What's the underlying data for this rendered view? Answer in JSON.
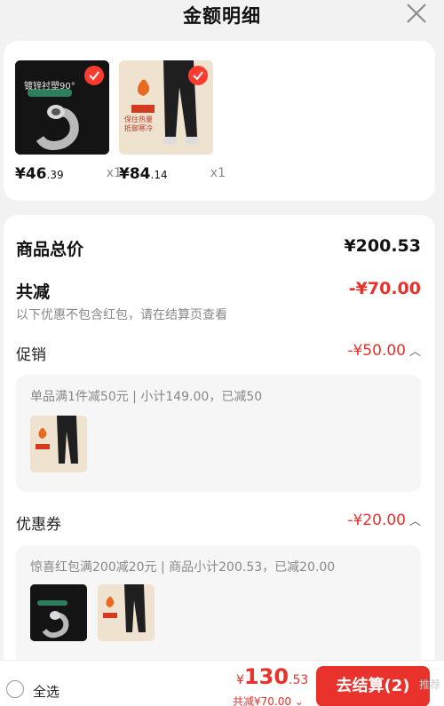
{
  "header": {
    "title": "金额明细"
  },
  "products": [
    {
      "thumb_text": "镀锌衬塑90°",
      "price_int": "¥46",
      "price_dec": ".39",
      "qty": "x1"
    },
    {
      "thumb_text": "保住热量 抵御寒冷",
      "price_int": "¥84",
      "price_dec": ".14",
      "qty": "x1"
    }
  ],
  "summary": {
    "goods_total_label": "商品总价",
    "goods_total_value": "¥200.53",
    "discount_label": "共减",
    "discount_value": "-¥70.00",
    "discount_hint": "以下优惠不包含红包，请在结算页查看"
  },
  "promotion": {
    "label": "促销",
    "value": "-¥50.00",
    "desc": "单品满1件减50元 | 小计149.00，已减50"
  },
  "coupon": {
    "label": "优惠券",
    "value": "-¥20.00",
    "desc": "惊喜红包满200减20元 | 商品小计200.53，已减20.00"
  },
  "bottom": {
    "select_all": "全选",
    "total_sym": "¥",
    "total_int": "130",
    "total_dec": ".53",
    "total_sub": "共减¥70.00 ⌄",
    "checkout": "去结算(2)",
    "recommend": "推荐"
  },
  "colors": {
    "accent": "#e8322b",
    "background": "#f2f2f2"
  },
  "icons": {
    "close": "close-icon",
    "check": "check-icon",
    "chevron": "chevron-up-icon"
  }
}
